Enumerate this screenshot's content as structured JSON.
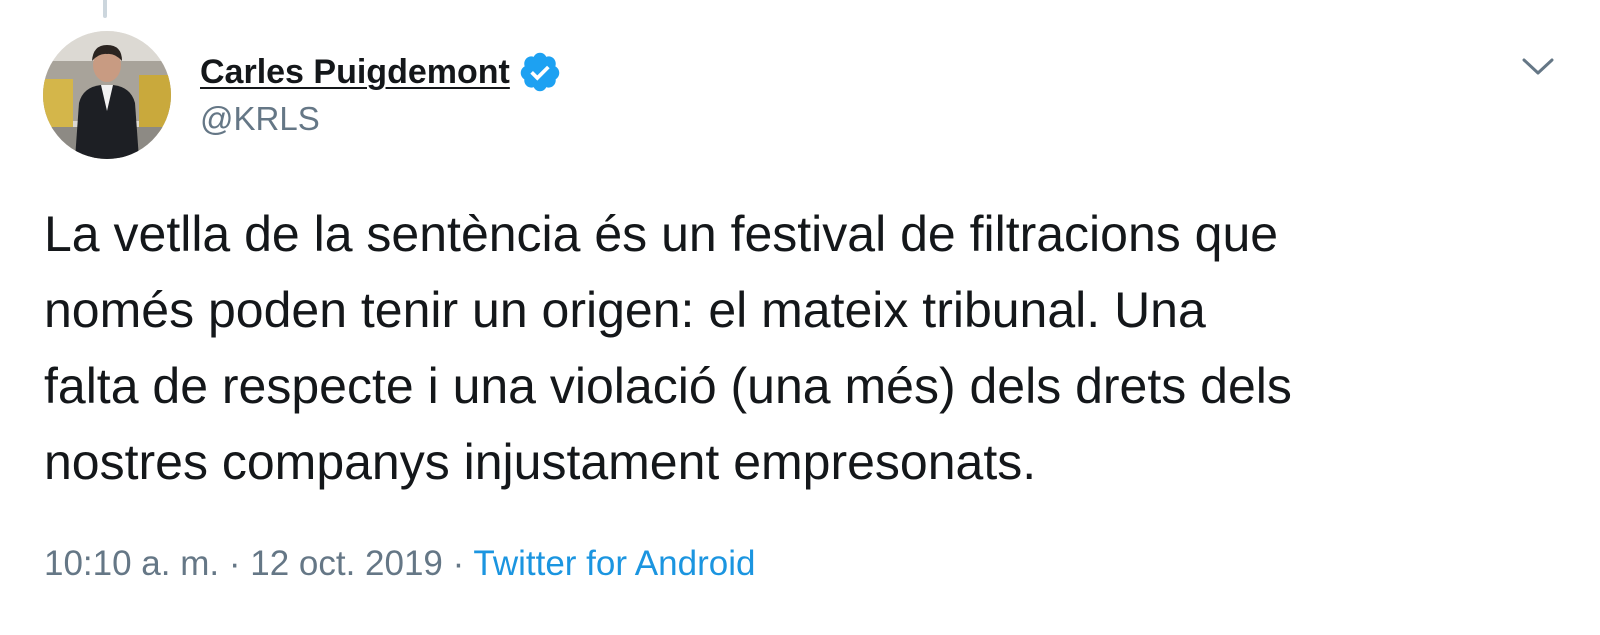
{
  "author": {
    "display_name": "Carles Puigdemont",
    "handle": "@KRLS",
    "verified": true
  },
  "tweet": {
    "lines": [
      "La vetlla de la sentència és un festival de filtracions que",
      "només poden tenir un origen: el mateix tribunal. Una",
      "falta de respecte i una violació (una més) dels drets dels",
      "nostres companys injustament empresonats."
    ]
  },
  "meta": {
    "time": "10:10 a. m.",
    "separator": "·",
    "date": "12 oct. 2019",
    "source": "Twitter for Android"
  },
  "icons": {
    "verified": "verified-badge-icon",
    "menu": "chevron-down-icon"
  },
  "colors": {
    "text": "#14171a",
    "secondary": "#657786",
    "link": "#1b95e0",
    "verified": "#1da1f2"
  }
}
